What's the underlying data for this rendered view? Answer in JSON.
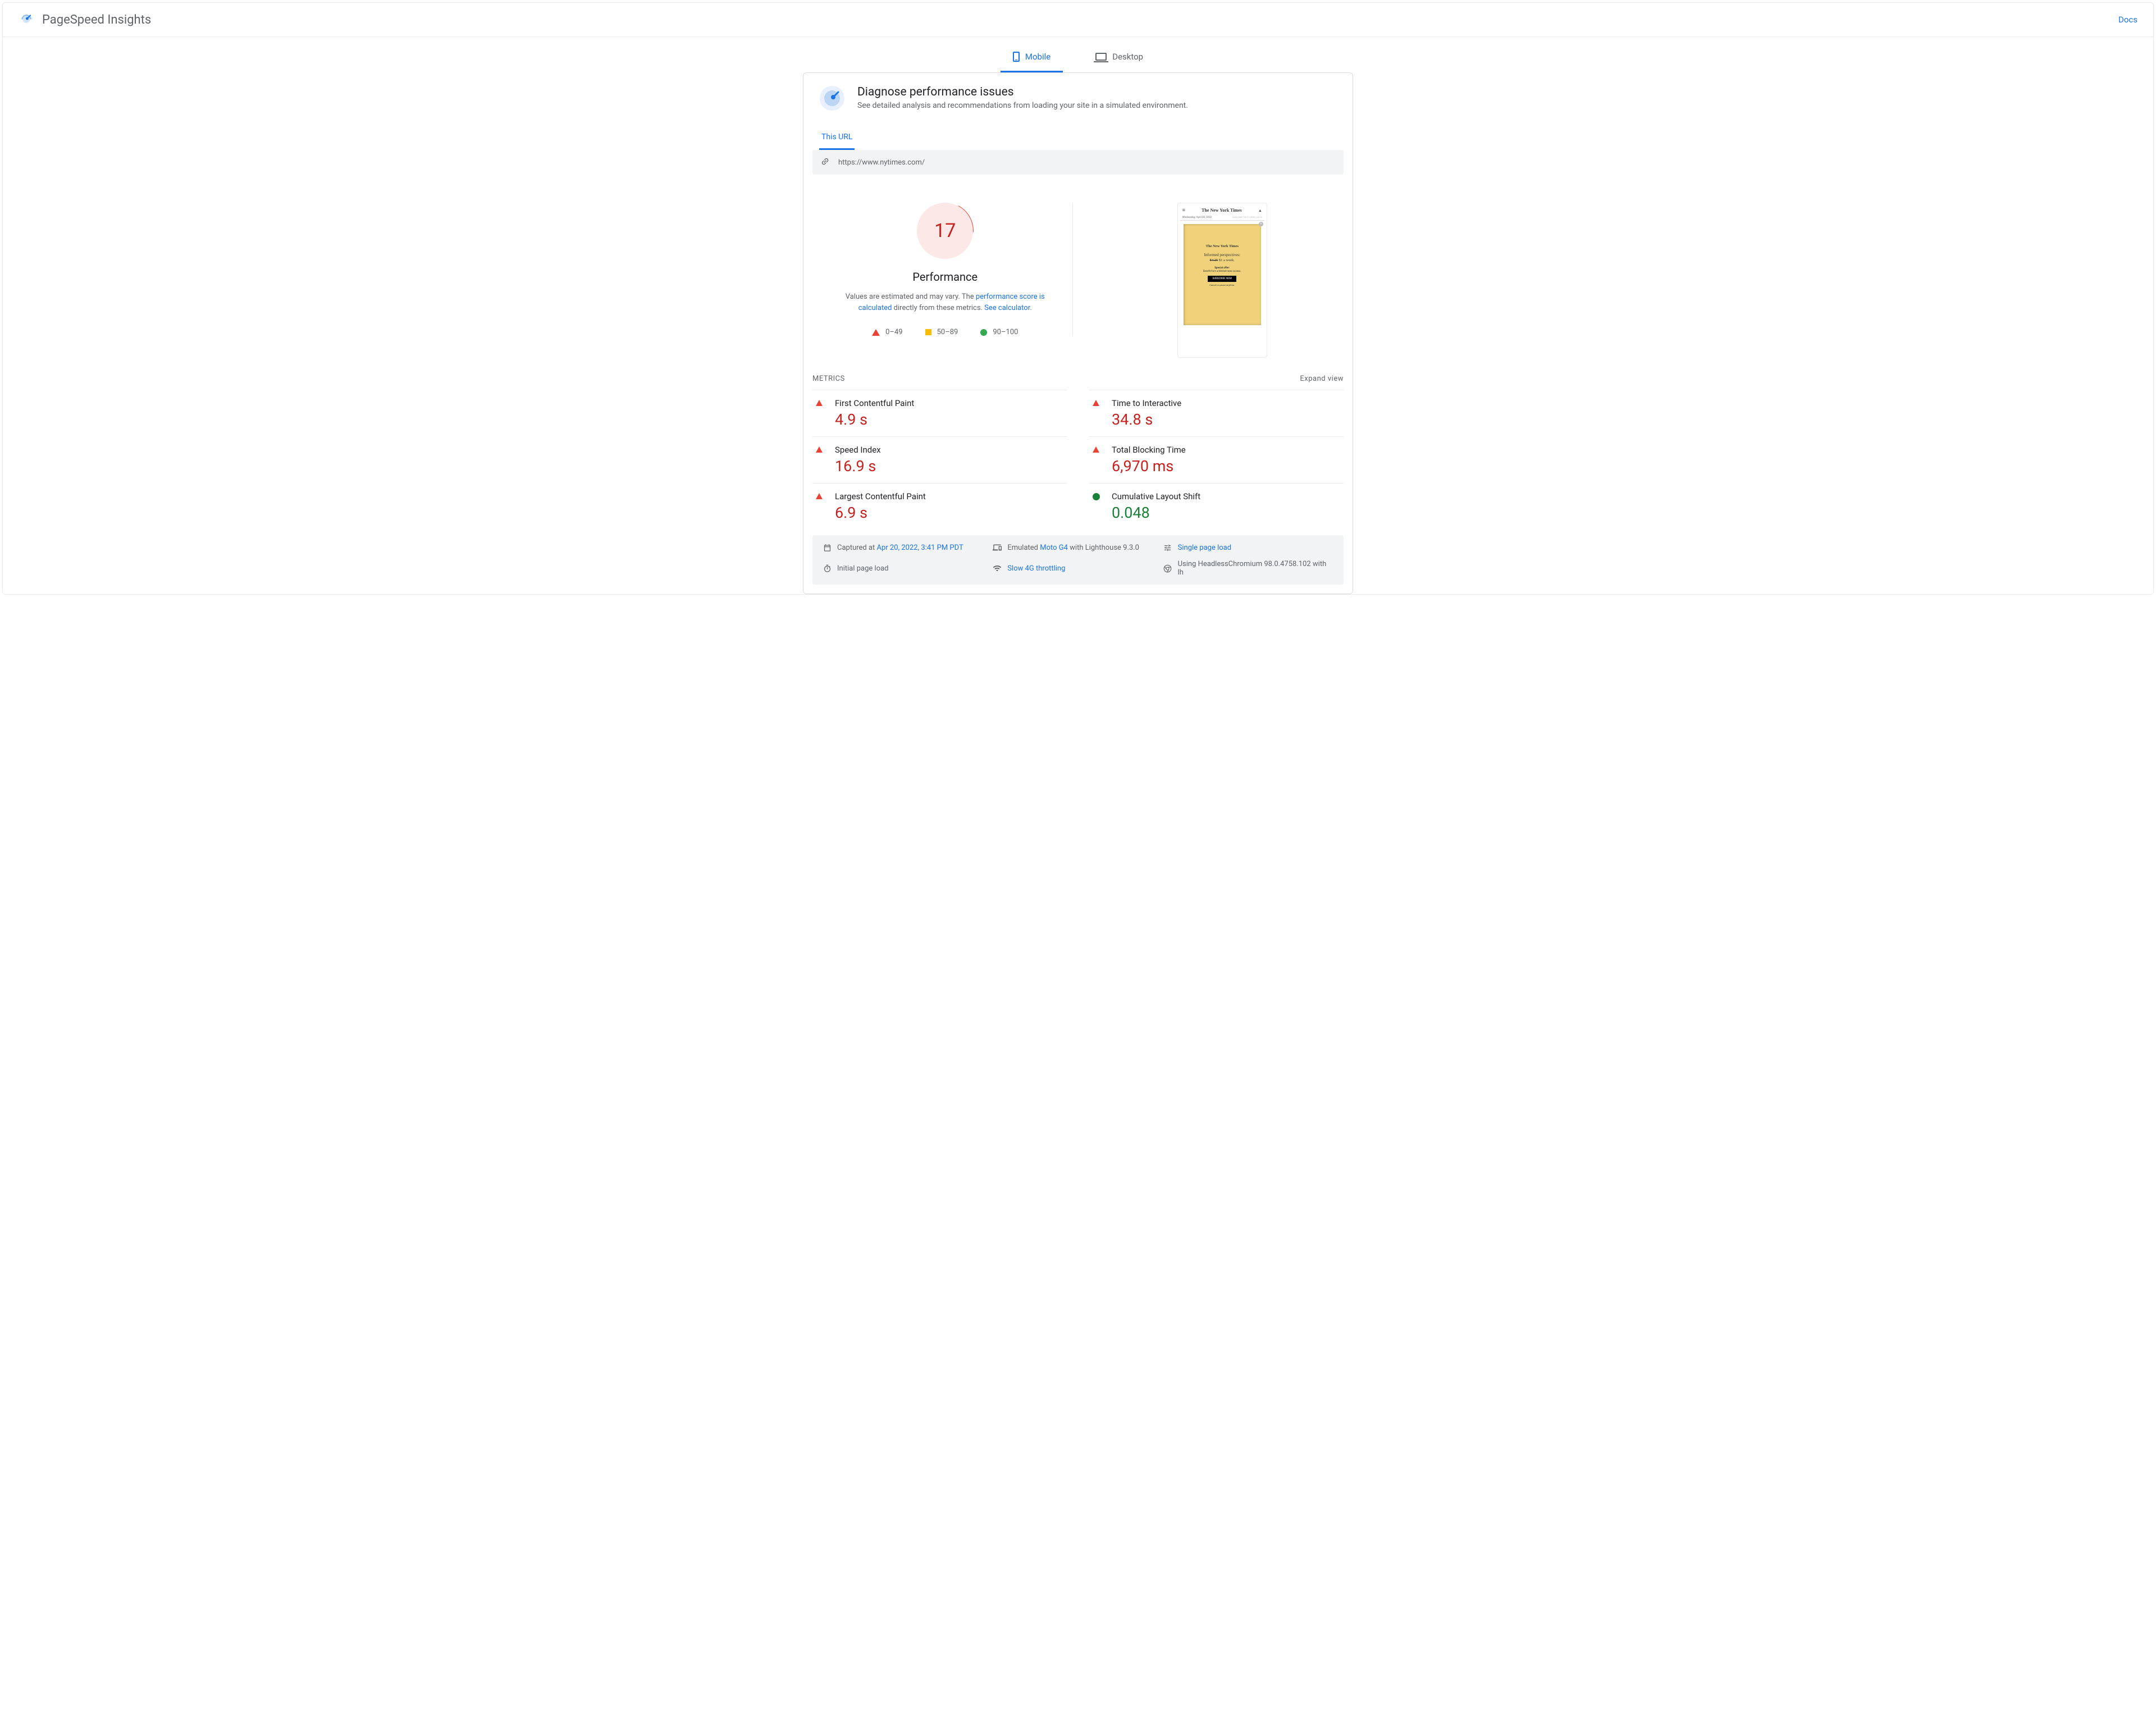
{
  "header": {
    "app_title": "PageSpeed Insights",
    "docs_label": "Docs"
  },
  "device_tabs": {
    "mobile": "Mobile",
    "desktop": "Desktop"
  },
  "diagnose": {
    "title": "Diagnose performance issues",
    "subtitle": "See detailed analysis and recommendations from loading your site in a simulated environment."
  },
  "url_tab_label": "This URL",
  "url_value": "https://www.nytimes.com/",
  "gauge": {
    "score": "17",
    "label": "Performance",
    "desc_prefix": "Values are estimated and may vary. The ",
    "desc_link1": "performance score is calculated",
    "desc_mid": " directly from these metrics. ",
    "desc_link2": "See calculator",
    "desc_suffix": "."
  },
  "legend": {
    "r": "0–49",
    "o": "50–89",
    "g": "90–100"
  },
  "thumbnail": {
    "logo": "The New York Times",
    "date": "Wednesday, April 20, 2022",
    "subnav": "SUBSCRIBE FOR $1/WEEK   LOG IN",
    "ad_logo": "The New York Times",
    "ad_headline": "Informed perspectives:",
    "ad_strike": "$4.25",
    "ad_price": " $1 a week.",
    "ad_special": "Special offer:",
    "ad_sub": "Benefit from unlimited news access.",
    "ad_button": "SUBSCRIBE NOW",
    "ad_cancel": "Cancel or pause anytime."
  },
  "metrics_label": "METRICS",
  "expand_label": "Expand view",
  "metrics_left": [
    {
      "name": "First Contentful Paint",
      "value": "4.9 s",
      "status": "red"
    },
    {
      "name": "Speed Index",
      "value": "16.9 s",
      "status": "red"
    },
    {
      "name": "Largest Contentful Paint",
      "value": "6.9 s",
      "status": "red"
    }
  ],
  "metrics_right": [
    {
      "name": "Time to Interactive",
      "value": "34.8 s",
      "status": "red"
    },
    {
      "name": "Total Blocking Time",
      "value": "6,970 ms",
      "status": "red"
    },
    {
      "name": "Cumulative Layout Shift",
      "value": "0.048",
      "status": "green"
    }
  ],
  "info": {
    "captured_prefix": "Captured at ",
    "captured_value": "Apr 20, 2022, 3:41 PM PDT",
    "emulated_prefix": "Emulated ",
    "emulated_device": "Moto G4",
    "emulated_suffix": " with Lighthouse 9.3.0",
    "single_load": "Single page load",
    "initial_load": "Initial page load",
    "throttling": "Slow 4G throttling",
    "chromium": "Using HeadlessChromium 98.0.4758.102 with lh"
  }
}
